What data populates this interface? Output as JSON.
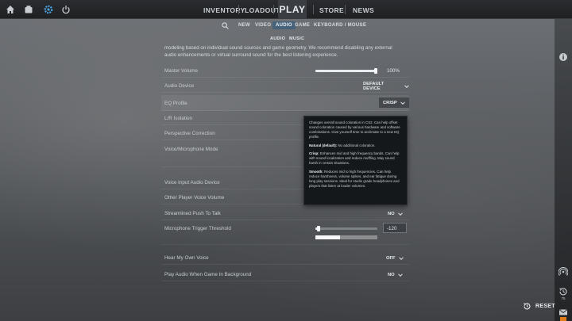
{
  "topbar": {
    "nav": [
      "INVENTORY",
      "LOADOUT",
      "PLAY",
      "STORE",
      "NEWS"
    ]
  },
  "settings_tabs": {
    "items": [
      "NEW",
      "VIDEO",
      "AUDIO",
      "GAME",
      "KEYBOARD / MOUSE"
    ],
    "active": "AUDIO"
  },
  "audio_subtabs": [
    "AUDIO",
    "MUSIC"
  ],
  "intro_text": "modeling based on individual sound sources and game geometry. We recommend disabling any external audio enhancements or virtual surround sound for the best listening experience.",
  "rows": {
    "master_volume": {
      "label": "Master Volume",
      "value": "100%",
      "level": 1.0
    },
    "audio_device": {
      "label": "Audio Device",
      "value": "DEFAULT DEVICE"
    },
    "eq_profile": {
      "label": "EQ Profile",
      "value": "CRISP"
    },
    "lr_isolation": {
      "label": "L/R Isolation"
    },
    "perspective_correction": {
      "label": "Perspective Correction"
    },
    "voice_mic_mode": {
      "label": "Voice/Microphone Mode"
    },
    "voice_input_device": {
      "label": "Voice Input Audio Device"
    },
    "other_player_volume": {
      "label": "Other Player Voice Volume"
    },
    "streamlined_ptt": {
      "label": "Streamlined Push To Talk",
      "value": "NO"
    },
    "mic_threshold": {
      "label": "Microphone Trigger Threshold",
      "value": "-120",
      "level": 0.05,
      "meter": 0.4
    },
    "hear_own_voice": {
      "label": "Hear My Own Voice",
      "value": "OFF"
    },
    "play_audio_bg": {
      "label": "Play Audio When Game In Background",
      "value": "NO"
    }
  },
  "tooltip": {
    "intro": "Changes overall sound coloration in CS2. Can help offset sound coloration caused by various hardware and software combinations. Give yourself time to acclimate to a new EQ profile.",
    "natural_title": "Natural (default):",
    "natural_text": " No additional coloration.",
    "crisp_title": "Crisp:",
    "crisp_text": " Enhances mid and high frequency bands. Can help with sound localization and reduce muffling. May sound harsh in certain situations.",
    "smooth_title": "Smooth:",
    "smooth_text": " Reduces mid to high frequencies. Can help reduce harshness, volume spikes, and ear fatigue during long play sessions. Ideal for studio grade headphones and players that listen at louder volumes."
  },
  "sidebar": {
    "friends_count": "75"
  },
  "reset_label": "RESET",
  "colors": {
    "accent_tab": "#46627a",
    "tooltip_bg": "#14181b",
    "mail_badge": "#e07b1a"
  }
}
